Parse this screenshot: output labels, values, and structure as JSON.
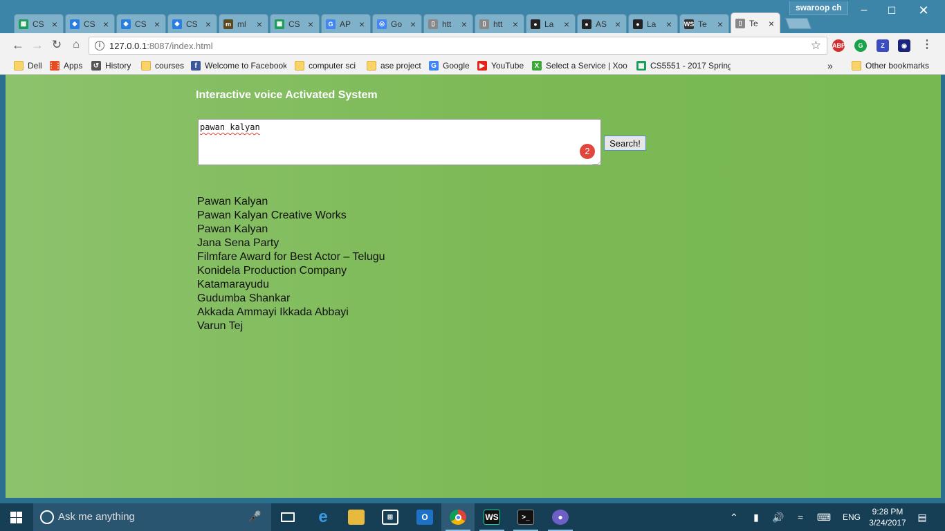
{
  "browser": {
    "tabs": [
      {
        "title": "CS",
        "icon": "sheets-icon",
        "color": "#1e9e5a"
      },
      {
        "title": "CS",
        "icon": "dropbox-icon",
        "color": "#2a7de1"
      },
      {
        "title": "CS",
        "icon": "dropbox-icon",
        "color": "#2a7de1"
      },
      {
        "title": "CS",
        "icon": "dropbox-icon",
        "color": "#2a7de1"
      },
      {
        "title": "ml",
        "icon": "ml-icon",
        "color": "#5b4a20"
      },
      {
        "title": "CS",
        "icon": "sheets-icon",
        "color": "#1e9e5a"
      },
      {
        "title": "AP",
        "icon": "google-icon",
        "color": "#4285f4"
      },
      {
        "title": "Go",
        "icon": "chrome-icon",
        "color": "#4285f4"
      },
      {
        "title": "htt",
        "icon": "page-icon",
        "color": "#888888"
      },
      {
        "title": "htt",
        "icon": "page-icon",
        "color": "#888888"
      },
      {
        "title": "La",
        "icon": "github-icon",
        "color": "#222222"
      },
      {
        "title": "AS",
        "icon": "github-icon",
        "color": "#222222"
      },
      {
        "title": "La",
        "icon": "github-icon",
        "color": "#222222"
      },
      {
        "title": "Te",
        "icon": "webstorm-icon",
        "color": "#333333"
      },
      {
        "title": "Te",
        "icon": "page-icon",
        "color": "#888888",
        "active": true
      }
    ],
    "profile_name": "swaroop ch",
    "url_host": "127.0.0.1",
    "url_rest": ":8087/index.html",
    "extensions": [
      {
        "label": "ABP",
        "color": "#d32f2f"
      },
      {
        "label": "G",
        "color": "#16a34a"
      },
      {
        "label": "Z",
        "color": "#3b4cc0"
      },
      {
        "label": "◉",
        "color": "#1a237e"
      }
    ],
    "bookmarks": [
      {
        "label": "Dell",
        "icon": "folder-icon"
      },
      {
        "label": "Apps",
        "icon": "apps-icon"
      },
      {
        "label": "History",
        "icon": "history-icon"
      },
      {
        "label": "courses",
        "icon": "folder-icon"
      },
      {
        "label": "Welcome to Facebook",
        "icon": "facebook-icon"
      },
      {
        "label": "computer sci",
        "icon": "folder-icon"
      },
      {
        "label": "ase project",
        "icon": "folder-icon"
      },
      {
        "label": "Google",
        "icon": "google-icon"
      },
      {
        "label": "YouTube",
        "icon": "youtube-icon"
      },
      {
        "label": "Select a Service | Xoom",
        "icon": "xoom-icon"
      },
      {
        "label": "CS5551 - 2017 Spring",
        "icon": "sheets-icon"
      }
    ],
    "more_bookmarks": "»",
    "other_bookmarks": "Other bookmarks"
  },
  "page": {
    "title": "Interactive voice Activated System",
    "query": "pawan kalyan",
    "badge_count": "2",
    "search_label": "Search!",
    "results": [
      "Pawan Kalyan",
      "Pawan Kalyan Creative Works",
      "Pawan Kalyan",
      "Jana Sena Party",
      "Filmfare Award for Best Actor – Telugu",
      "Konidela Production Company",
      "Katamarayudu",
      "Gudumba Shankar",
      "Akkada Ammayi Ikkada Abbayi",
      "Varun Tej"
    ],
    "background_color": "#7ab953"
  },
  "taskbar": {
    "search_placeholder": "Ask me anything",
    "language": "ENG",
    "time": "9:28 PM",
    "date": "3/24/2017"
  }
}
